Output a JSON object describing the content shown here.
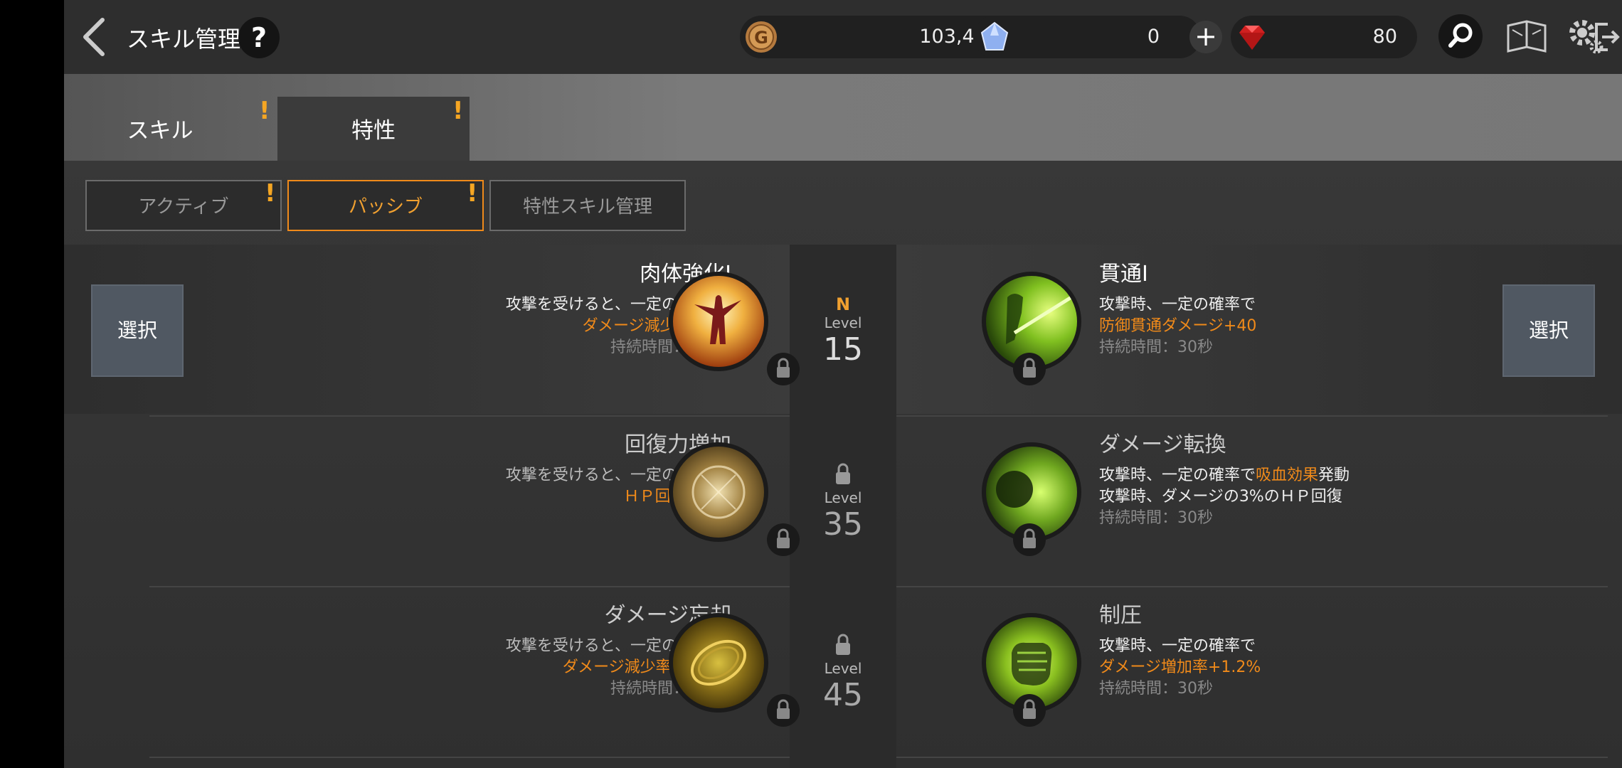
{
  "header": {
    "title": "スキル管理",
    "help": "?",
    "gold": "103,482",
    "crystal": "0",
    "crystal_plus": "+",
    "ruby": "80"
  },
  "tabs": [
    {
      "label": "スキル",
      "alert": "!"
    },
    {
      "label": "特性",
      "alert": "!"
    }
  ],
  "subtabs": [
    {
      "label": "アクティブ",
      "alert": "!"
    },
    {
      "label": "パッシブ",
      "alert": "!"
    },
    {
      "label": "特性スキル管理"
    }
  ],
  "select_label": "選択",
  "levels": [
    {
      "badge": "N",
      "label": "Level",
      "value": "15"
    },
    {
      "label": "Level",
      "value": "35"
    },
    {
      "label": "Level",
      "value": "45"
    }
  ],
  "skills_left": [
    {
      "name": "肉体強化Ⅰ",
      "line1": "攻撃を受けると、一定の確率で",
      "line2": "ダメージ減少量+40",
      "duration": "持続時間：30秒"
    },
    {
      "name": "回復力増加",
      "line1": "攻撃を受けると、一定の確率で",
      "line2": "ＨＰ回復+3%"
    },
    {
      "name": "ダメージ忘却",
      "line1": "攻撃を受けると、一定の確率で",
      "line2": "ダメージ減少率+1.8%",
      "duration": "持続時間：30秒"
    }
  ],
  "skills_right": [
    {
      "name": "貫通Ⅰ",
      "line1": "攻撃時、一定の確率で",
      "line2": "防御貫通ダメージ+40",
      "duration": "持続時間：30秒"
    },
    {
      "name": "ダメージ転換",
      "line1a": "攻撃時、一定の確率で",
      "line1b": "吸血効果",
      "line1c": "発動",
      "line2": "攻撃時、ダメージの3%のＨＰ回復",
      "duration": "持続時間：30秒"
    },
    {
      "name": "制圧",
      "line1": "攻撃時、一定の確率で",
      "line2": "ダメージ増加率+1.2%",
      "duration": "持続時間：30秒"
    }
  ]
}
